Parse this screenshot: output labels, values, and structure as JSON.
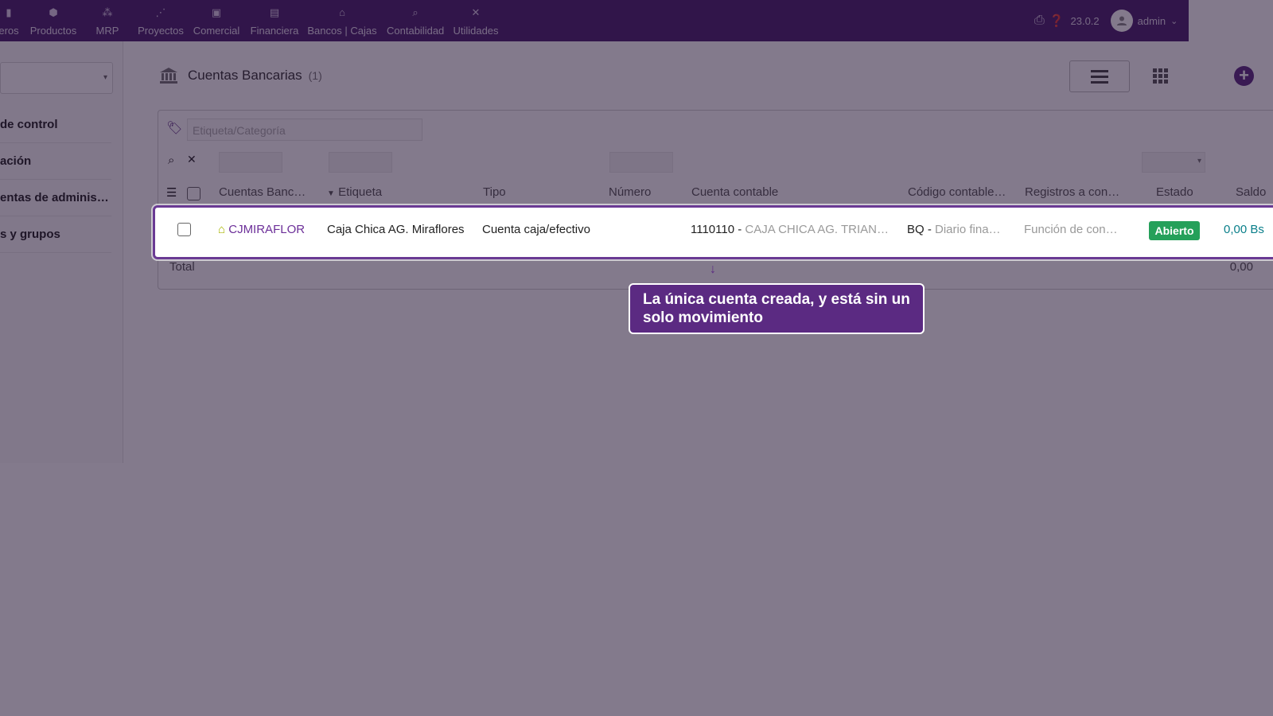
{
  "topbar": {
    "menu": [
      {
        "label": "eros",
        "icon": "bar-chart-icon"
      },
      {
        "label": "Productos",
        "icon": "cube-icon"
      },
      {
        "label": "MRP",
        "icon": "cubes-icon"
      },
      {
        "label": "Proyectos",
        "icon": "sitemap-icon"
      },
      {
        "label": "Comercial",
        "icon": "briefcase-icon"
      },
      {
        "label": "Financiera",
        "icon": "file-icon"
      },
      {
        "label": "Bancos | Cajas",
        "icon": "bank-icon"
      },
      {
        "label": "Contabilidad",
        "icon": "search-dollar-icon"
      },
      {
        "label": "Utilidades",
        "icon": "tools-icon"
      }
    ],
    "version": "23.0.2",
    "user": "admin"
  },
  "left": {
    "items": [
      "de control",
      "ación",
      "entas de administ…",
      "s y grupos"
    ]
  },
  "main": {
    "title": "Cuentas Bancarias",
    "count": "(1)",
    "tag_placeholder": "Etiqueta/Categoría",
    "columns": [
      "Cuentas Banc…",
      "Etiqueta",
      "Tipo",
      "Número",
      "Cuenta contable",
      "Código contable…",
      "Registros a con…",
      "Estado",
      "Saldo"
    ],
    "row": {
      "ref": "CJMIRAFLOR",
      "label": "Caja Chica AG. Miraflores",
      "type": "Cuenta caja/efectivo",
      "account_code": "1110110 -",
      "account_name": "CAJA CHICA AG. TRIAN…",
      "journal_code": "BQ -",
      "journal_name": "Diario fina…",
      "records": "Función de con…",
      "status": "Abierto",
      "balance": "0,00 Bs"
    },
    "total_label": "Total",
    "total_value": "0,00"
  },
  "tooltip": {
    "text": "La única cuenta creada, y está sin un solo movimiento"
  },
  "colors": {
    "topbar": "#4a1f6e",
    "accent": "#5b2a82",
    "status_open": "#25a05a",
    "balance": "#0a7f8a"
  }
}
